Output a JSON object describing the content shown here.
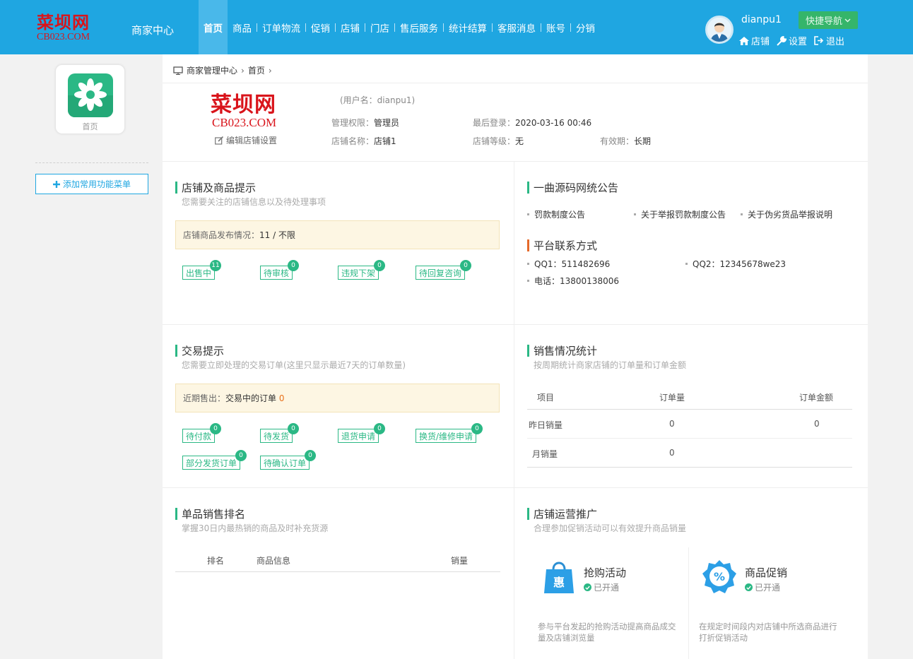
{
  "header": {
    "logo_cn": "菜坝网",
    "logo_en": "CB023.COM",
    "center_title": "商家中心",
    "nav": [
      "首页",
      "商品",
      "订单物流",
      "促销",
      "店铺",
      "门店",
      "售后服务",
      "统计结算",
      "客服消息",
      "账号",
      "分销"
    ],
    "active_nav": "首页",
    "username": "dianpu1",
    "quick_nav": "快捷导航",
    "links": {
      "shop": "店铺",
      "settings": "设置",
      "logout": "退出"
    }
  },
  "sidebar": {
    "home_label": "首页",
    "add_menu": "添加常用功能菜单"
  },
  "breadcrumb": {
    "root": "商家管理中心",
    "current": "首页"
  },
  "profile": {
    "logo_cn": "菜坝网",
    "logo_en": "CB023.COM",
    "edit_shop": "编辑店铺设置",
    "username_line": "(用户名：dianpu1)",
    "permission_label": "管理权限：",
    "permission_value": "管理员",
    "last_login_label": "最后登录：",
    "last_login_value": "2020-03-16 00:46",
    "shop_name_label": "店铺名称：",
    "shop_name_value": "店铺1",
    "shop_level_label": "店铺等级：",
    "shop_level_value": "无",
    "validity_label": "有效期：",
    "validity_value": "长期"
  },
  "shop_tips": {
    "title": "店铺及商品提示",
    "subtitle": "您需要关注的店铺信息以及待处理事项",
    "box_label": "店铺商品发布情况：",
    "box_value": "11 /  不限",
    "tags": [
      {
        "label": "出售中",
        "count": "11"
      },
      {
        "label": "待审核",
        "count": "0"
      },
      {
        "label": "违规下架",
        "count": "0"
      },
      {
        "label": "待回复咨询",
        "count": "0"
      }
    ]
  },
  "announce": {
    "title": "一曲源码网统公告",
    "items": [
      "罚款制度公告",
      "关于举报罚款制度公告",
      "关于伪劣货品举报说明"
    ],
    "contact_title": "平台联系方式",
    "qq1": "QQ1：511482696",
    "qq2": "QQ2：12345678we23",
    "phone": "电话：13800138006"
  },
  "trade_tips": {
    "title": "交易提示",
    "subtitle": "您需要立即处理的交易订单(这里只显示最近7天的订单数量)",
    "box_label": "近期售出：",
    "box_mid": "交易中的订单",
    "box_value": "0",
    "tags": [
      {
        "label": "待付款",
        "count": "0"
      },
      {
        "label": "待发货",
        "count": "0"
      },
      {
        "label": "退货申请",
        "count": "0"
      },
      {
        "label": "换货/维修申请",
        "count": "0"
      },
      {
        "label": "部分发货订单",
        "count": "0"
      },
      {
        "label": "待确认订单",
        "count": "0"
      }
    ]
  },
  "sales_stats": {
    "title": "销售情况统计",
    "subtitle": "按周期统计商家店铺的订单量和订单金额",
    "headers": [
      "项目",
      "订单量",
      "订单金额"
    ],
    "rows": [
      [
        "昨日销量",
        "0",
        "0"
      ],
      [
        "月销量",
        "0",
        ""
      ]
    ]
  },
  "ranking": {
    "title": "单品销售排名",
    "subtitle": "掌握30日内最热销的商品及时补充货源",
    "headers": [
      "排名",
      "商品信息",
      "销量"
    ]
  },
  "promotion": {
    "title": "店铺运营推广",
    "subtitle": "合理参加促销活动可以有效提升商品销量",
    "items": [
      {
        "name": "抢购活动",
        "icon_text": "惠",
        "status": "已开通",
        "desc": "参与平台发起的抢购活动提高商品成交量及店铺浏览量"
      },
      {
        "name": "商品促销",
        "icon_text": "%",
        "status": "已开通",
        "desc": "在规定时间段内对店铺中所选商品进行打折促销活动"
      }
    ]
  },
  "colors": {
    "header": "#1fa6e1",
    "accent_green": "#2bb885",
    "accent_orange": "#e56a2a"
  }
}
